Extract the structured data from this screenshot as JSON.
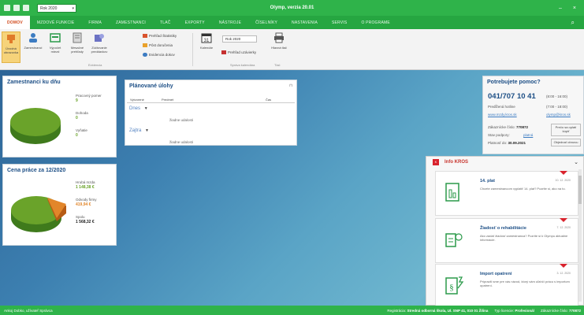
{
  "titlebar": {
    "period": "Rok 2020",
    "window_title": "Olymp, verzia 20.01",
    "minimize": "–",
    "close": "×"
  },
  "menu": {
    "tabs": [
      "DOMOV",
      "MZDOVÉ FUNKCIE",
      "FIRMA",
      "ZAMESTNANCI",
      "TLAČ",
      "EXPORTY",
      "NÁSTROJE",
      "ČÍSELNÍKY",
      "NASTAVENIA",
      "SERVIS",
      "O PROGRAME"
    ],
    "active_index": 0
  },
  "ribbon": {
    "buttons": [
      {
        "label": "Úvodná obrazovka"
      },
      {
        "label": "Zamestnanci"
      },
      {
        "label": "Výpočet miezd"
      },
      {
        "label": "Mesačné prehľady"
      },
      {
        "label": "Zúčtovanie preddavkov"
      }
    ],
    "small_items": [
      "Prehľad Štatistiky",
      "Pôst doručenia",
      "Evidencia dokov"
    ],
    "group_domov": "Evidencia",
    "calendar_label": "Kalendár",
    "calendar_select": "Rok 2020",
    "lock_label": "Prehľad uzávierky",
    "print_label": "Hlavná tlač",
    "group_calendar": "Správa kalendára",
    "group_print": "Tlač"
  },
  "employees_panel": {
    "title": "Zamestnanci ku dňu",
    "items": [
      {
        "label": "Pracovný pomer",
        "value": "9"
      },
      {
        "label": "Dohoda",
        "value": "0"
      },
      {
        "label": "Vyňatie",
        "value": "0"
      }
    ]
  },
  "labor_panel": {
    "title": "Cena práce za 12/2020",
    "items": [
      {
        "label": "Hrubá mzda",
        "value": "1 148,38 €"
      },
      {
        "label": "Odvody firmy",
        "value": "419,94 €"
      },
      {
        "label": "Spolu",
        "value": "1 568,32 €"
      }
    ]
  },
  "planned_panel": {
    "title": "Plánované úlohy",
    "pin": "⊓",
    "columns": [
      "Vytvorené",
      "Predmet",
      "Čas"
    ],
    "groups": [
      {
        "label": "Dnes",
        "empty": "žiadne udalosti"
      },
      {
        "label": "Zajtra",
        "empty": "žiadne udalosti"
      }
    ]
  },
  "help_panel": {
    "title": "Potrebujete pomoc?",
    "phone": "041/707 10 41",
    "hours": "(8:00 - 16:00)",
    "extended_label": "Predĺžená hotline",
    "extended_hours": "(7:00 - 18:00)",
    "web_link": "www.mzdy.kros.sk",
    "email_link": "olymp@kros.sk",
    "contract_label": "Zákaznícke číslo:",
    "contract_value": "770872",
    "service_label": "Stav podpory:",
    "service_link": "platná",
    "valid_label": "Platnosť do:",
    "valid_value": "30.09.2021",
    "btn_license": "Prečo sa oplatí kúpiť",
    "btn_order": "Objednať obnovu"
  },
  "info_panel": {
    "logo": "K",
    "title": "Info KROS",
    "cards": [
      {
        "title": "14. plat",
        "date": "10. 12. 2020",
        "body": "Chcete zamestnancom vyplatiť 14. plat? Pozrite si, ako na to."
      },
      {
        "title": "Žiadosť o rehabilitácie",
        "date": "7. 12. 2020",
        "body": "Ako zadať žiadosť zamestnanca? Pozrite si k Olympu aktuálne informácie."
      },
      {
        "title": "Import opatrení",
        "date": "3. 12. 2020",
        "body": "Pripravili sme pre vás návod, ktorý vám uľahčí prácu s importom opatrení."
      }
    ]
  },
  "statusbar": {
    "user": "Ankoj Dobko, užívateľ Správca",
    "license_label": "Registrácia:",
    "license_value": "Stredná odborná škola, Ul. SNP 41, 010 01 Žilina",
    "type_label": "Typ licencie:",
    "type_value": "Profesionál",
    "customer_label": "Zákaznícke číslo:",
    "customer_value": "770872"
  },
  "colors": {
    "accent_green": "#2fb34a",
    "tab_active_text": "#d04a1c",
    "heading_blue": "#1d4f86",
    "pie_green": "#6aa32a",
    "pie_orange": "#e2862a",
    "kros_red": "#d9232d"
  },
  "icons": [
    "home-icon",
    "users-icon",
    "payroll-icon",
    "report-icon",
    "settlement-icon",
    "calendar-icon",
    "lock-icon",
    "printer-icon",
    "help-icon",
    "doc-icon",
    "bulb-icon",
    "law-icon"
  ]
}
